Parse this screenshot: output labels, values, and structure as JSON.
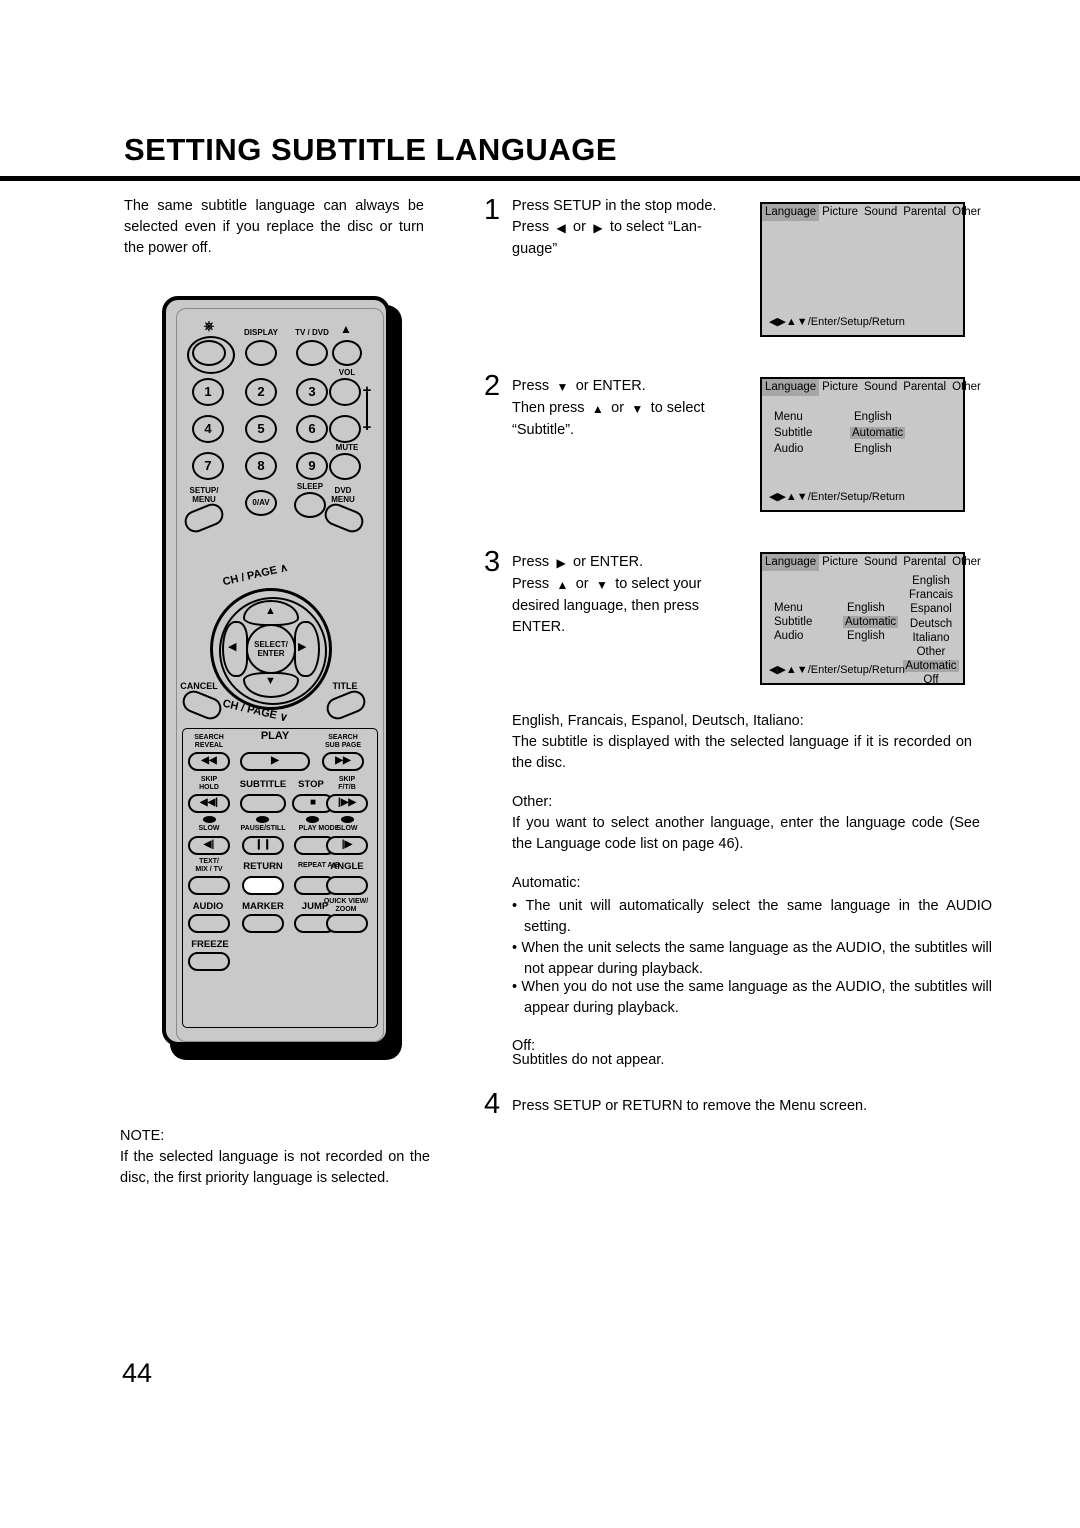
{
  "header": {
    "title": "SETTING SUBTITLE LANGUAGE"
  },
  "page_number": "44",
  "intro": "The same subtitle language can always be selected even if you replace the disc or turn the power off.",
  "note": {
    "label": "NOTE:",
    "text": "If the selected language is not recorded on the disc, the first priority language is selected."
  },
  "steps": [
    {
      "num": "1",
      "line1": "Press SETUP in the stop mode.",
      "line2_a": "Press",
      "line2_b": "or",
      "line2_c": "to select “Lan-",
      "line3": "guage”"
    },
    {
      "num": "2",
      "line1_a": "Press",
      "line1_b": "or ENTER.",
      "line2_a": "Then press",
      "line2_b": "or",
      "line2_c": "to select",
      "line3": "“Subtitle”."
    },
    {
      "num": "3",
      "line1_a": "Press",
      "line1_b": "or ENTER.",
      "line2_a": "Press",
      "line2_b": "or",
      "line2_c": "to select your",
      "line3": "desired language, then press",
      "line4": "ENTER."
    },
    {
      "num": "4",
      "line1": "Press SETUP or RETURN to remove the Menu screen."
    }
  ],
  "descriptions": {
    "languages_heading": "English, Francais, Espanol, Deutsch, Italiano:",
    "languages_body": "The subtitle is displayed with the selected language if it is recorded on the disc.",
    "other_heading": "Other:",
    "other_body": "If you want to select another language, enter the language code (See the Language code list on page 46).",
    "automatic_heading": "Automatic:",
    "automatic_bullets": [
      "The unit will automatically select the same language in the AUDIO setting.",
      "When the unit selects the same language as the AUDIO, the subtitles will not appear during playback.",
      "When you do not use the same language as the AUDIO, the subtitles will appear during playback."
    ],
    "off_heading": "Off:",
    "off_body": "Subtitles do not appear."
  },
  "osd": {
    "tabs": [
      "Language",
      "Picture",
      "Sound",
      "Parental",
      "Other"
    ],
    "active_tab": "Language",
    "footer": "◀▶▲▼/Enter/Setup/Return",
    "screen2": {
      "rows": [
        {
          "label": "Menu",
          "value": "English",
          "highlighted": false
        },
        {
          "label": "Subtitle",
          "value": "Automatic",
          "highlighted": true
        },
        {
          "label": "Audio",
          "value": "English",
          "highlighted": false
        }
      ]
    },
    "screen3": {
      "rows": [
        {
          "label": "Menu",
          "value": "English",
          "highlighted": false
        },
        {
          "label": "Subtitle",
          "value": "Automatic",
          "highlighted": true
        },
        {
          "label": "Audio",
          "value": "English",
          "highlighted": false
        }
      ],
      "options": [
        "English",
        "Francais",
        "Espanol",
        "Deutsch",
        "Italiano",
        "Other",
        "Automatic",
        "Off"
      ],
      "selected_option": "Automatic"
    }
  },
  "remote": {
    "top_labels": {
      "display": "DISPLAY",
      "tvdvd": "TV / DVD",
      "eject": "▲",
      "vol": "VOL",
      "plus": "+",
      "minus": "−",
      "mute": "MUTE",
      "sleep": "SLEEP"
    },
    "numbers": [
      "1",
      "2",
      "3",
      "4",
      "5",
      "6",
      "7",
      "8",
      "9"
    ],
    "zero_av": "0/AV",
    "setup_menu": "SETUP/\nMENU",
    "setup_menu_l1": "SETUP/",
    "setup_menu_l2": "MENU",
    "dvd_menu_l1": "DVD",
    "dvd_menu_l2": "MENU",
    "chpage_up": "CH / PAGE ∧",
    "chpage_dn": "CH / PAGE ∨",
    "cancel": "CANCEL",
    "title": "TITLE",
    "select_enter_l1": "SELECT/",
    "select_enter_l2": "ENTER",
    "transport": {
      "search_reveal_l1": "SEARCH",
      "search_reveal_l2": "REVEAL",
      "play": "PLAY",
      "search_subpage_l1": "SEARCH",
      "search_subpage_l2": "SUB PAGE",
      "skip_hold_l1": "SKIP",
      "skip_hold_l2": "HOLD",
      "subtitle": "SUBTITLE",
      "stop": "STOP",
      "skip_ftb_l1": "SKIP",
      "skip_ftb_l2": "F/T/B",
      "slow_left": "SLOW",
      "pause_still": "PAUSE/STILL",
      "play_mode": "PLAY MODE",
      "slow_right": "SLOW",
      "text_mix_l1": "TEXT/",
      "text_mix_l2": "MIX / TV",
      "return": "RETURN",
      "repeat_ab": "REPEAT A-B",
      "angle": "ANGLE",
      "audio": "AUDIO",
      "marker": "MARKER",
      "jump": "JUMP",
      "quick_view_l1": "QUICK VIEW/",
      "quick_view_l2": "ZOOM",
      "freeze": "FREEZE"
    }
  }
}
